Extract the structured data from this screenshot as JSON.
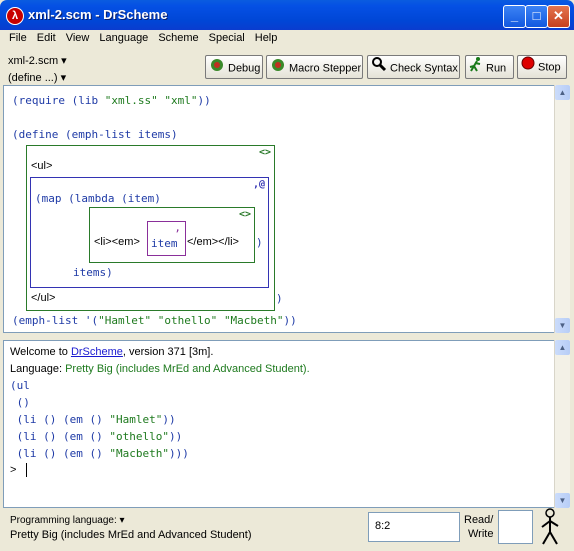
{
  "window": {
    "title": "xml-2.scm - DrScheme"
  },
  "menu": [
    "File",
    "Edit",
    "View",
    "Language",
    "Scheme",
    "Special",
    "Help"
  ],
  "toolbar": {
    "file_name": "xml-2.scm ▾",
    "define_menu": "(define ...) ▾",
    "debug": "Debug",
    "macro_stepper": "Macro Stepper",
    "check_syntax": "Check Syntax",
    "run": "Run",
    "stop": "Stop"
  },
  "definitions": {
    "line1_pre": "(require (lib ",
    "line1_s1": "\"xml.ss\"",
    "line1_s2": "\"xml\"",
    "line1_post": "))",
    "line2": "(define (emph-list items)",
    "box_badge": "<>",
    "ul_open": "<ul>",
    "unquote_badge": ",@",
    "map_line": "(map (lambda (item)",
    "li_open": "<li><em>",
    "comma": ",",
    "item": "item",
    "li_close": "</em></li>",
    "close_paren1": ")",
    "items": "items)",
    "ul_close": "</ul>",
    "close_paren2": ")",
    "call_pre": "(emph-list '(",
    "call_s1": "\"Hamlet\"",
    "call_s2": "\"othello\"",
    "call_s3": "\"Macbeth\"",
    "call_post": "))"
  },
  "interactions": {
    "welcome_pre": "Welcome to ",
    "welcome_link": "DrScheme",
    "welcome_post": ", version 371 [3m].",
    "language_pre": "Language: ",
    "language_val": "Pretty Big (includes MrEd and Advanced Student).",
    "out1": "(ul",
    "out2": " ()",
    "out3_pre": " (li () (em () ",
    "out3_s": "\"Hamlet\"",
    "out3_post": "))",
    "out4_pre": " (li () (em () ",
    "out4_s": "\"othello\"",
    "out4_post": "))",
    "out5_pre": " (li () (em () ",
    "out5_s": "\"Macbeth\"",
    "out5_post": ")))",
    "prompt": ">"
  },
  "status": {
    "lang_label": "Programming language: ▾",
    "lang_value": "Pretty Big (includes MrEd and Advanced Student)",
    "position": "8:2",
    "rw_line1": "Read/",
    "rw_line2": "Write"
  },
  "colors": {
    "titlebar": "#0550e4",
    "code_blue": "#1e3aa6",
    "string_green": "#1e7a1e"
  },
  "icons": [
    "drscheme-logo-icon",
    "debug-bug-icon",
    "macro-stepper-icon",
    "magnifier-icon",
    "runner-icon",
    "stop-icon",
    "walking-figure-icon"
  ]
}
